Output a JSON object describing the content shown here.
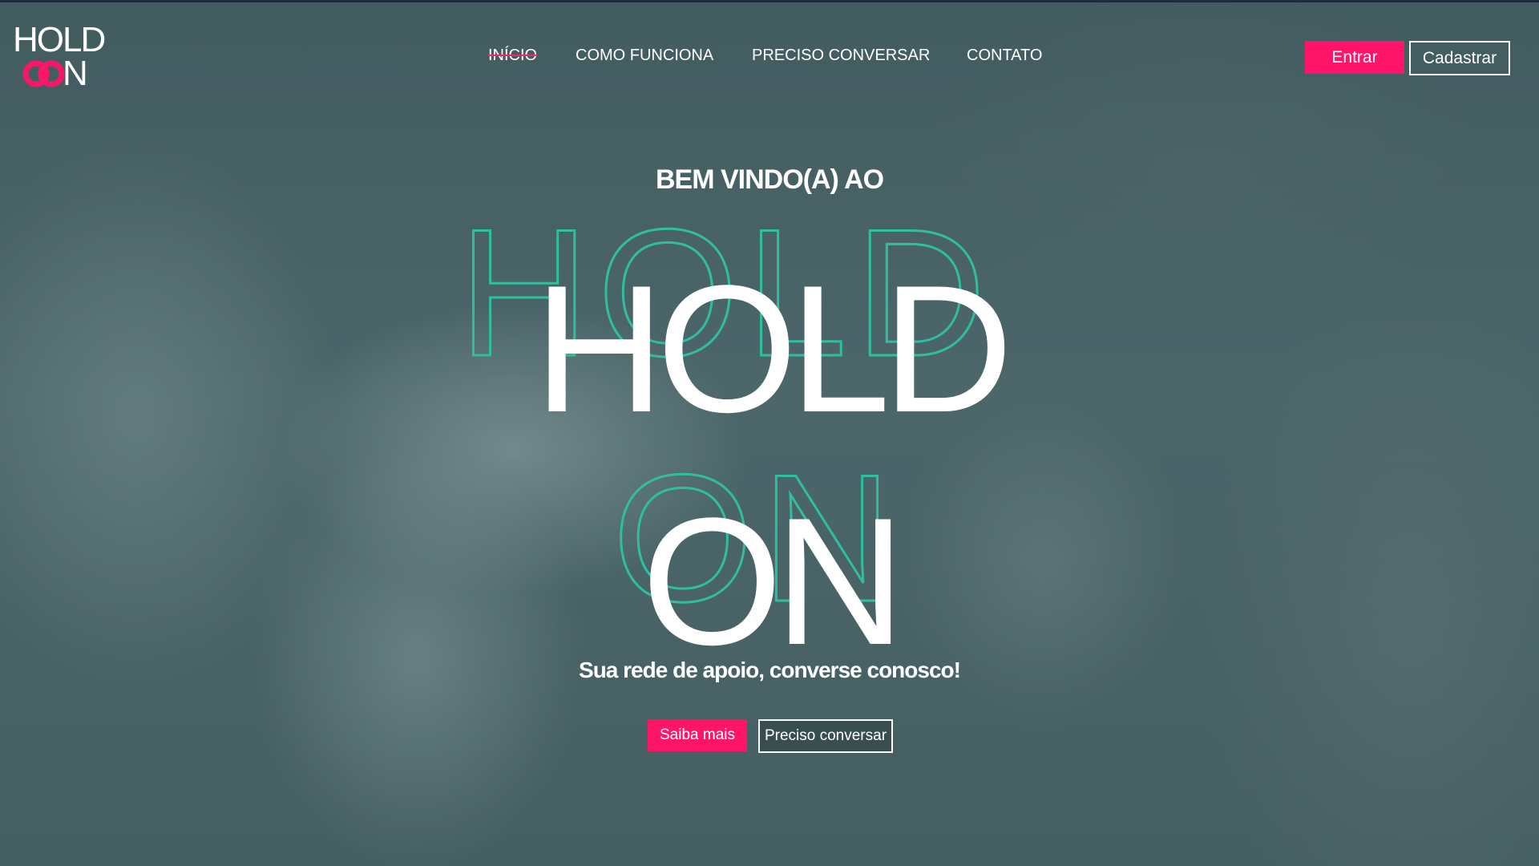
{
  "logo": {
    "line1": "HOLD",
    "line2_letter": "N",
    "ring_color": "#ff1568",
    "icon": "linked-rings-icon"
  },
  "nav": {
    "items": [
      {
        "label": "INÍCIO",
        "active": true
      },
      {
        "label": "COMO FUNCIONA",
        "active": false
      },
      {
        "label": "PRECISO CONVERSAR",
        "active": false
      },
      {
        "label": "CONTATO",
        "active": false
      }
    ]
  },
  "auth": {
    "login_label": "Entrar",
    "signup_label": "Cadastrar"
  },
  "hero": {
    "welcome": "BEM VINDO(A) AO",
    "title_line1": "HOLD",
    "title_line2": "ON",
    "tagline": "Sua rede de apoio, converse conosco!",
    "primary_button": "Saiba mais",
    "secondary_button": "Preciso conversar"
  },
  "colors": {
    "accent": "#ff1568",
    "outline_accent": "#2fbf9e",
    "text": "#ffffff"
  }
}
